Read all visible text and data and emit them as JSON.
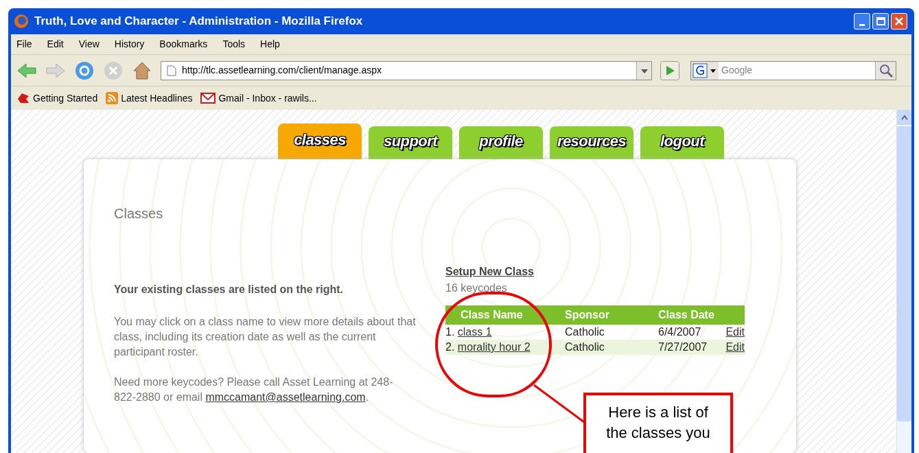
{
  "window": {
    "title": "Truth, Love and Character - Administration - Mozilla Firefox"
  },
  "menu": [
    "File",
    "Edit",
    "View",
    "History",
    "Bookmarks",
    "Tools",
    "Help"
  ],
  "address_bar": {
    "value": "http://tlc.assetlearning.com/client/manage.aspx"
  },
  "search": {
    "placeholder": "Google"
  },
  "bookmarks": [
    "Getting Started",
    "Latest Headlines",
    "Gmail - Inbox - rawils..."
  ],
  "tabs": [
    {
      "label": "classes",
      "selected": true
    },
    {
      "label": "support",
      "selected": false
    },
    {
      "label": "profile",
      "selected": false
    },
    {
      "label": "resources",
      "selected": false
    },
    {
      "label": "logout",
      "selected": false
    }
  ],
  "page": {
    "heading": "Classes",
    "intro": "Your existing classes are listed on the right.",
    "body": "You may click on a class name to view more details about that class, including its creation date as well as the current participant roster.",
    "contact": "Need more keycodes? Please call Asset Learning at 248-822-2880 or email ",
    "email": "mmccamant@assetlearning.com",
    "contact_end": "."
  },
  "setup_link": "Setup New Class",
  "keycodes": "16 keycodes",
  "table": {
    "columns": [
      "Class Name",
      "Sponsor",
      "Class Date"
    ],
    "rows": [
      {
        "index": "1.",
        "name": "class 1",
        "sponsor": "Catholic",
        "date": "6/4/2007",
        "action": "Edit"
      },
      {
        "index": "2.",
        "name": "morality hour 2",
        "sponsor": "Catholic",
        "date": "7/27/2007",
        "action": "Edit"
      }
    ]
  },
  "callout": {
    "lines": [
      "Here is a list of",
      "the classes you"
    ]
  }
}
